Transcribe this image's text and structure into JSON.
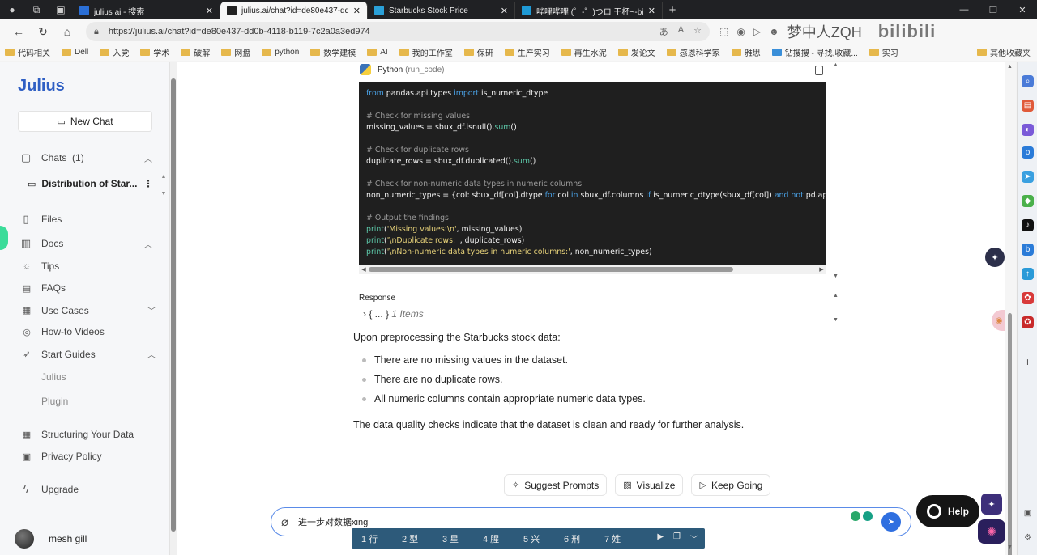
{
  "browser": {
    "tabs": [
      {
        "title": "julius ai - 搜索",
        "color": "#2b6fd6"
      },
      {
        "title": "julius.ai/chat?id=de80e437-dd0",
        "color": "#222222",
        "active": true
      },
      {
        "title": "Starbucks Stock Price",
        "color": "#2aa0d8"
      },
      {
        "title": "哔哩哔哩 (゜-゜)つロ 干杯~-bili",
        "color": "#1f9ad6"
      }
    ],
    "url": "https://julius.ai/chat?id=de80e437-dd0b-4118-b119-7c2a0a3ed974",
    "bookmarks": [
      "代码相关",
      "Dell",
      "入党",
      "学术",
      "破解",
      "网盘",
      "python",
      "数学建模",
      "AI",
      "我的工作室",
      "保研",
      "生产实习",
      "再生水泥",
      "发论文",
      "感恩科学家",
      "雅思",
      "钻搜搜 - 寻找,收藏...",
      "实习"
    ],
    "bookmarks_more": "其他收藏夹",
    "bili_user": "梦中人ZQH",
    "bili_logo": "bilibili"
  },
  "sidebar": {
    "logo": "Julius",
    "new_chat": "New Chat",
    "chats_label": "Chats",
    "chats_count": "(1)",
    "chat_title": "Distribution of Star...",
    "files": "Files",
    "docs": "Docs",
    "tips": "Tips",
    "faqs": "FAQs",
    "use_cases": "Use Cases",
    "how_to": "How-to Videos",
    "start_guides": "Start Guides",
    "guide_julius": "Julius",
    "guide_plugin": "Plugin",
    "structuring": "Structuring Your Data",
    "privacy": "Privacy Policy",
    "upgrade": "Upgrade",
    "user_name": "mesh gill"
  },
  "code_block": {
    "lang": "Python",
    "sub": "(run_code)"
  },
  "response": {
    "label": "Response",
    "prefix": "› { ... }",
    "items": "1 Items"
  },
  "answer": {
    "intro": "Upon preprocessing the Starbucks stock data:",
    "bullets": [
      "There are no missing values in the dataset.",
      "There are no duplicate rows.",
      "All numeric columns contain appropriate numeric data types."
    ],
    "conclusion": "The data quality checks indicate that the dataset is clean and ready for further analysis."
  },
  "actions": {
    "suggest": "Suggest Prompts",
    "visualize": "Visualize",
    "keep_going": "Keep Going"
  },
  "input": {
    "value": "进一步对数据xing"
  },
  "ime": {
    "candidates": [
      "1 行",
      "2 型",
      "3 星",
      "4 腥",
      "5 兴",
      "6 刑",
      "7 姓"
    ]
  },
  "help": {
    "label": "Help"
  },
  "colors": {
    "brand": "#2f5fc4",
    "send": "#2f6fe0",
    "code_bg": "#1f1f1f"
  }
}
